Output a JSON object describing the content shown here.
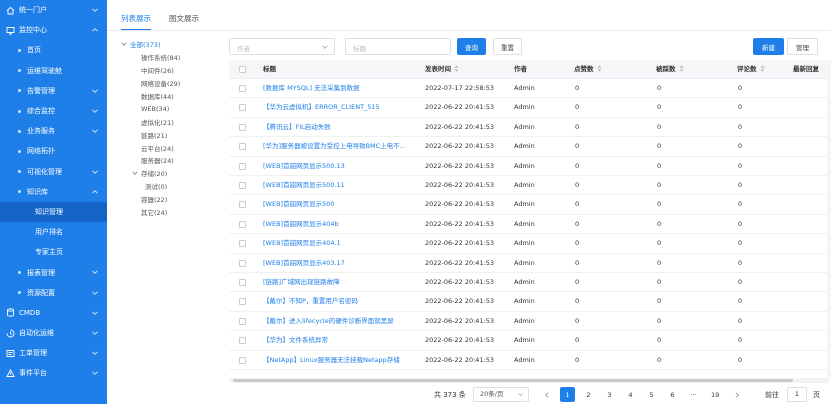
{
  "sidebar": {
    "items": [
      {
        "label": "统一门户",
        "level": 0,
        "icon": "home-icon",
        "expandable": true,
        "expanded": false
      },
      {
        "label": "监控中心",
        "level": 0,
        "icon": "monitor-icon",
        "expandable": true,
        "expanded": true
      },
      {
        "label": "首页",
        "level": 1,
        "expandable": false
      },
      {
        "label": "运维驾驶舱",
        "level": 1,
        "expandable": false
      },
      {
        "label": "告警管理",
        "level": 1,
        "expandable": true,
        "expanded": false
      },
      {
        "label": "综合监控",
        "level": 1,
        "expandable": true,
        "expanded": false
      },
      {
        "label": "业务服务",
        "level": 1,
        "expandable": true,
        "expanded": false
      },
      {
        "label": "网络拓扑",
        "level": 1,
        "expandable": false
      },
      {
        "label": "可视化管理",
        "level": 1,
        "expandable": true,
        "expanded": false
      },
      {
        "label": "知识库",
        "level": 1,
        "expandable": true,
        "expanded": true
      },
      {
        "label": "知识管理",
        "level": 2,
        "active": true
      },
      {
        "label": "用户排名",
        "level": 2
      },
      {
        "label": "专家主页",
        "level": 2
      },
      {
        "label": "报表管理",
        "level": 1,
        "expandable": true,
        "expanded": false
      },
      {
        "label": "资源配置",
        "level": 1,
        "expandable": true,
        "expanded": false
      },
      {
        "label": "CMDB",
        "level": 0,
        "icon": "database-icon",
        "expandable": true,
        "expanded": false
      },
      {
        "label": "自动化运维",
        "level": 0,
        "icon": "automation-icon",
        "expandable": true,
        "expanded": false
      },
      {
        "label": "工单管理",
        "level": 0,
        "icon": "ticket-icon",
        "expandable": true,
        "expanded": false
      },
      {
        "label": "事件平台",
        "level": 0,
        "icon": "event-icon",
        "expandable": true,
        "expanded": false
      }
    ]
  },
  "tabs": [
    {
      "label": "列表展示",
      "active": true
    },
    {
      "label": "图文展示",
      "active": false
    }
  ],
  "tree": [
    {
      "label": "全部(373)",
      "level": 0,
      "expanded": true
    },
    {
      "label": "操作系统(84)",
      "level": 1
    },
    {
      "label": "中间件(26)",
      "level": 1
    },
    {
      "label": "网络设备(29)",
      "level": 1
    },
    {
      "label": "数据库(44)",
      "level": 1
    },
    {
      "label": "WEB(34)",
      "level": 1
    },
    {
      "label": "虚拟化(21)",
      "level": 1
    },
    {
      "label": "链路(21)",
      "level": 1
    },
    {
      "label": "云平台(24)",
      "level": 1
    },
    {
      "label": "服务器(24)",
      "level": 1
    },
    {
      "label": "存储(20)",
      "level": 1,
      "expanded": true
    },
    {
      "label": "测试(0)",
      "level": 2
    },
    {
      "label": "容器(22)",
      "level": 1
    },
    {
      "label": "其它(24)",
      "level": 1
    }
  ],
  "filter": {
    "author_placeholder": "作者",
    "title_placeholder": "标题",
    "query_label": "查询",
    "reset_label": "重置",
    "new_label": "新建",
    "manage_label": "管理"
  },
  "table": {
    "headers": {
      "title": "标题",
      "time": "发表时间",
      "author": "作者",
      "likes": "点赞数",
      "dislikes": "被踩数",
      "comments": "评论数",
      "last": "最新回复"
    },
    "rows": [
      {
        "title": "[数据库 MYSQL] 无法采集到数据",
        "time": "2022-07-17 22:58:53",
        "author": "Admin",
        "likes": "0",
        "dislikes": "0",
        "comments": "0"
      },
      {
        "title": "【华为云虚拟机】ERROR_CLIENT_515",
        "time": "2022-06-22 20:41:53",
        "author": "Admin",
        "likes": "0",
        "dislikes": "0",
        "comments": "0"
      },
      {
        "title": "【腾讯云】FIL启动失败",
        "time": "2022-06-22 20:41:53",
        "author": "Admin",
        "likes": "0",
        "dislikes": "0",
        "comments": "0"
      },
      {
        "title": "[华为]服务器被设置为受控上电导致BMC上电不...",
        "time": "2022-06-22 20:41:53",
        "author": "Admin",
        "likes": "0",
        "dislikes": "0",
        "comments": "0"
      },
      {
        "title": "[WEB]首韶网页显示500.13",
        "time": "2022-06-22 20:41:53",
        "author": "Admin",
        "likes": "0",
        "dislikes": "0",
        "comments": "0"
      },
      {
        "title": "[WEB]首韶网页显示500.11",
        "time": "2022-06-22 20:41:53",
        "author": "Admin",
        "likes": "0",
        "dislikes": "0",
        "comments": "0"
      },
      {
        "title": "[WEB]首韶网页显示500",
        "time": "2022-06-22 20:41:53",
        "author": "Admin",
        "likes": "0",
        "dislikes": "0",
        "comments": "0"
      },
      {
        "title": "[WEB]首韶网页显示404b",
        "time": "2022-06-22 20:41:53",
        "author": "Admin",
        "likes": "0",
        "dislikes": "0",
        "comments": "0"
      },
      {
        "title": "[WEB]首韶网页显示404.1",
        "time": "2022-06-22 20:41:53",
        "author": "Admin",
        "likes": "0",
        "dislikes": "0",
        "comments": "0"
      },
      {
        "title": "[WEB]首韶网页显示403.17",
        "time": "2022-06-22 20:41:53",
        "author": "Admin",
        "likes": "0",
        "dislikes": "0",
        "comments": "0"
      },
      {
        "title": "[链路]广域网出现链路故障",
        "time": "2022-06-22 20:41:53",
        "author": "Admin",
        "likes": "0",
        "dislikes": "0",
        "comments": "0"
      },
      {
        "title": "【戴尔】不知P，重置用户名密码",
        "time": "2022-06-22 20:41:53",
        "author": "Admin",
        "likes": "0",
        "dislikes": "0",
        "comments": "0"
      },
      {
        "title": "【戴尔】进入lifecycle的硬件诊断界面就黑屏",
        "time": "2022-06-22 20:41:53",
        "author": "Admin",
        "likes": "0",
        "dislikes": "0",
        "comments": "0"
      },
      {
        "title": "【华为】文件系统异常",
        "time": "2022-06-22 20:41:53",
        "author": "Admin",
        "likes": "0",
        "dislikes": "0",
        "comments": "0"
      },
      {
        "title": "【NetApp】Linux服务器无法挂载Netapp存储",
        "time": "2022-06-22 20:41:53",
        "author": "Admin",
        "likes": "0",
        "dislikes": "0",
        "comments": "0"
      }
    ]
  },
  "pagination": {
    "total": "共 373 条",
    "page_size": "20条/页",
    "pages": [
      "1",
      "2",
      "3",
      "4",
      "5",
      "6",
      "···",
      "19"
    ],
    "current": "1",
    "goto_prefix": "前往",
    "goto_value": "1",
    "goto_suffix": "页"
  },
  "colors": {
    "accent": "#1f7fe8",
    "sidebar_bg": "#1f7fe8",
    "sidebar_active": "#1565c8"
  }
}
